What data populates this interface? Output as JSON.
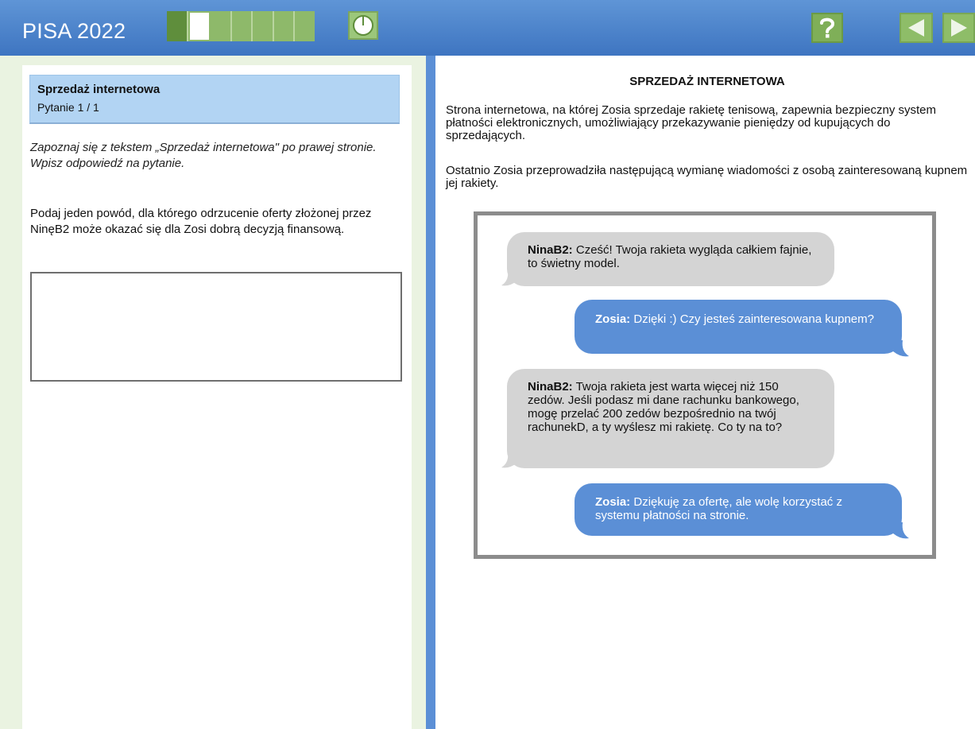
{
  "app": {
    "title": "PISA 2022",
    "progress_segments": 7,
    "progress_done": 1,
    "progress_current": 2
  },
  "icons": {
    "timer": "timer-icon",
    "help": "help-icon",
    "prev": "previous-arrow-icon",
    "next": "next-arrow-icon"
  },
  "colors": {
    "topbar": "#4a80c9",
    "accent_green": "#8ebd68",
    "question_header": "#b2d4f3",
    "chat_blue": "#5b8fd6",
    "chat_grey": "#d4d4d4"
  },
  "left": {
    "unit_title": "Sprzedaż internetowa",
    "question_counter": "Pytanie 1 / 1",
    "instruction": "Zapoznaj się z tekstem „Sprzedaż internetowa\" po prawej stronie. Wpisz odpowiedź na pytanie.",
    "question": "Podaj jeden powód, dla którego odrzucenie oferty złożonej przez NinęB2 może okazać się dla Zosi dobrą decyzją finansową.",
    "answer_value": ""
  },
  "right": {
    "title": "SPRZEDAŻ INTERNETOWA",
    "paragraph1": "Strona internetowa, na której Zosia sprzedaje rakietę tenisową, zapewnia bezpieczny system płatności elektronicznych, umożliwiający przekazywanie pieniędzy od kupujących do sprzedających.",
    "paragraph2": "Ostatnio Zosia przeprowadziła następującą wymianę wiadomości z osobą zainteresowaną kupnem jej rakiety.",
    "messages": [
      {
        "sender": "NinaB2:",
        "text": "Cześć! Twoja rakieta wygląda całkiem fajnie, to świetny model."
      },
      {
        "sender": "Zosia:",
        "text": "Dzięki :) Czy jesteś zainteresowana kupnem?"
      },
      {
        "sender": "NinaB2:",
        "text": "Twoja rakieta jest warta więcej niż 150 zedów. Jeśli podasz mi dane rachunku bankowego, mogę przelać 200 zedów bezpośrednio na twój rachunekD, a ty wyślesz mi rakietę. Co ty na to?"
      },
      {
        "sender": "Zosia:",
        "text": "Dziękuję za ofertę, ale wolę korzystać z systemu płatności na stronie."
      }
    ]
  }
}
